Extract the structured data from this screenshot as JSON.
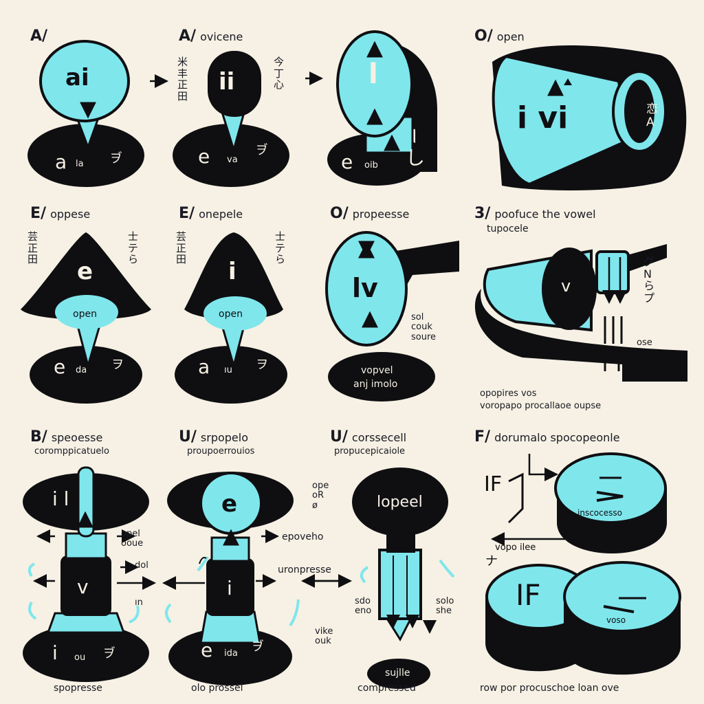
{
  "colors": {
    "background": "#f6f1e4",
    "accent": "#7fe6ec",
    "ink": "#0f0f12"
  },
  "panels": [
    {
      "id": "p1",
      "header_key": "A/",
      "header_text": "",
      "bubble": "ai",
      "base_letter": "a",
      "base_small": "la",
      "base_kana": "ヺ"
    },
    {
      "id": "p2",
      "header_key": "A/",
      "header_text": "ovicene",
      "bubble": "ii",
      "base_letter": "e",
      "base_small": "va",
      "base_kana": "ヺ",
      "side_left": "米\n丰\n正\n田",
      "side_right": "今\n丁\n心"
    },
    {
      "id": "p3",
      "header_key": "",
      "header_text": "",
      "bubble": "l",
      "base_letter": "e",
      "base_small": "oib",
      "base_kana": "し"
    },
    {
      "id": "p4",
      "header_key": "O/",
      "header_text": "open",
      "bubble": "i vi",
      "side_right": "恋\nA"
    },
    {
      "id": "p5",
      "header_key": "E/",
      "header_text": "oppese",
      "bubble": "e",
      "inner": "open",
      "base_letter": "e",
      "base_small": "da",
      "base_kana": "ヲ",
      "side_left": "芸\n正\n田",
      "side_right": "士\nテ\nら"
    },
    {
      "id": "p6",
      "header_key": "E/",
      "header_text": "onepele",
      "bubble": "i",
      "inner": "open",
      "base_letter": "a",
      "base_small": "ıu",
      "base_kana": "ヲ",
      "side_left": "芸\n正\n田",
      "side_right": "士\nテ\nら"
    },
    {
      "id": "p7",
      "header_key": "O/",
      "header_text": "propeesse",
      "bubble": "lv",
      "side_text": "sol\ncouk\nsoure",
      "base_text_1": "vopvel",
      "base_text_2": "anj imolo"
    },
    {
      "id": "p8",
      "header_key": "3/",
      "header_text": "poofuce the vowel",
      "subheader": "tupocele",
      "bubble": "v",
      "side_right": "グ\nN\nら\nプ",
      "side_small": "ose",
      "caption_1": "opopires vos",
      "caption_2": "voropapo procallaoe oupse"
    },
    {
      "id": "p9",
      "header_key": "B/",
      "header_text": "speoesse",
      "subheader": "coromppicatuelo",
      "top": "i l",
      "mid": "v",
      "base_letter": "i",
      "base_small": "ou",
      "base_kana": "ヺ",
      "side_1": "opel\nooue",
      "side_2": "dol",
      "side_3": "ın",
      "caption": "spopresse"
    },
    {
      "id": "p10",
      "header_key": "U/",
      "header_text": "srpopelo",
      "subheader": "proupoerrouios",
      "top": "e",
      "mid": "i",
      "base_letter": "e",
      "base_small": "ida",
      "base_kana": "ヺ",
      "side_1": "ope\noR\nø",
      "side_2": "epoveho",
      "side_3": "uronpresse",
      "caption": "olo prossel"
    },
    {
      "id": "p11",
      "header_key": "U/",
      "header_text": "corssecell",
      "subheader": "propucepicaiole",
      "top": "lopeel",
      "side_1": "vike\nouk",
      "side_2": "sdo\neno",
      "side_3": "solo\nshe",
      "base": "sujlle",
      "caption": "compressed"
    },
    {
      "id": "p12",
      "header_key": "F/",
      "header_text": "dorumalo spocopeonle",
      "disc_1_text": "inscocesso",
      "disc_2_text": "voso",
      "left_glyph": "IF",
      "mid_text": "vopo ilee",
      "kana": "ナ",
      "caption": "row por procuschoe loan ove"
    }
  ]
}
